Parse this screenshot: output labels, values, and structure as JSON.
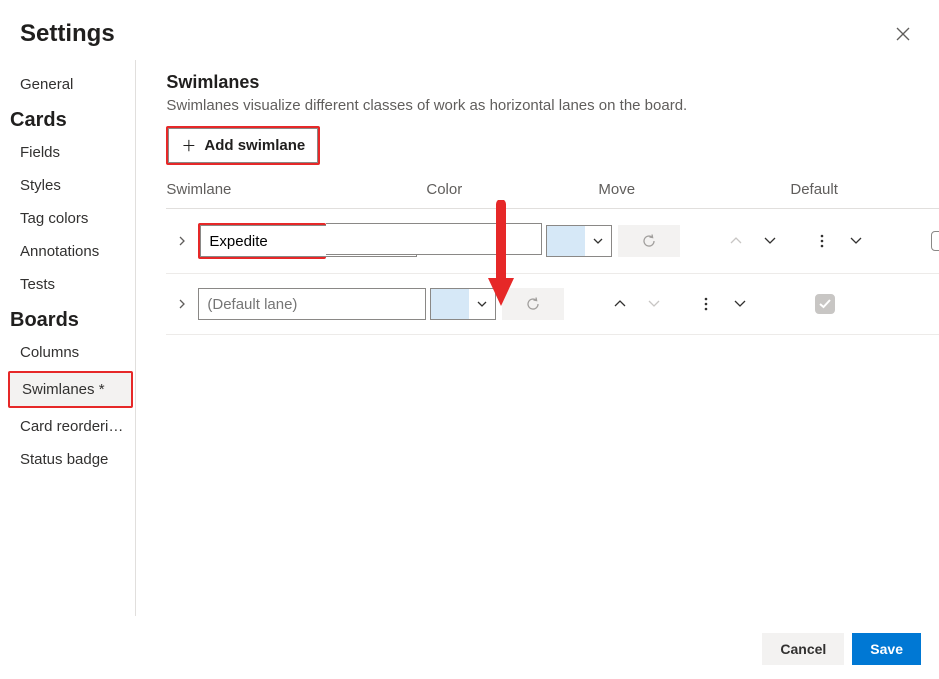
{
  "header": {
    "title": "Settings"
  },
  "sidebar": {
    "groups": [
      {
        "heading": null,
        "items": [
          {
            "label": "General",
            "active": false
          }
        ]
      },
      {
        "heading": "Cards",
        "items": [
          {
            "label": "Fields",
            "active": false
          },
          {
            "label": "Styles",
            "active": false
          },
          {
            "label": "Tag colors",
            "active": false
          },
          {
            "label": "Annotations",
            "active": false
          },
          {
            "label": "Tests",
            "active": false
          }
        ]
      },
      {
        "heading": "Boards",
        "items": [
          {
            "label": "Columns",
            "active": false
          },
          {
            "label": "Swimlanes *",
            "active": true,
            "highlighted": true
          },
          {
            "label": "Card reorderi…",
            "active": false
          },
          {
            "label": "Status badge",
            "active": false
          }
        ]
      }
    ]
  },
  "main": {
    "title": "Swimlanes",
    "description": "Swimlanes visualize different classes of work as horizontal lanes on the board.",
    "add_label": "Add swimlane",
    "columns": {
      "name": "Swimlane",
      "color": "Color",
      "move": "Move",
      "default": "Default"
    },
    "rows": [
      {
        "name": "Expedite",
        "name_highlighted": true,
        "placeholder": "",
        "color": "#d6e8f7",
        "up_enabled": false,
        "down_enabled": true,
        "default_checked": false,
        "default_disabled": false,
        "deletable": true
      },
      {
        "name": "",
        "name_highlighted": false,
        "placeholder": "(Default lane)",
        "color": "#d6e8f7",
        "up_enabled": true,
        "down_enabled": false,
        "default_checked": true,
        "default_disabled": true,
        "deletable": false
      }
    ]
  },
  "footer": {
    "cancel": "Cancel",
    "save": "Save"
  },
  "annotations": {
    "add_button_highlight": true,
    "arrow_pointing_to_name_input": true
  }
}
